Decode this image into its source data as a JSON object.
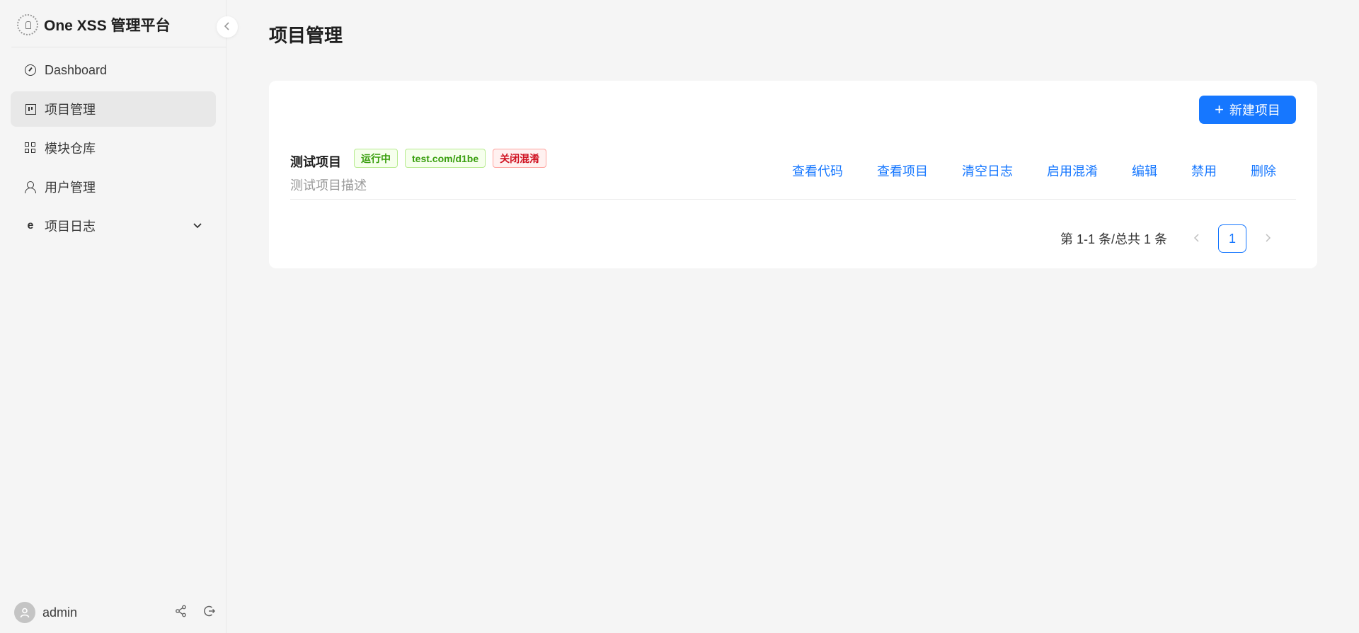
{
  "sidebar": {
    "brand_title": "One XSS 管理平台",
    "collapse_icon": "chevron-left-icon",
    "items": [
      {
        "label": "Dashboard",
        "icon": "dashboard-icon",
        "active": false
      },
      {
        "label": "项目管理",
        "icon": "project-icon",
        "active": true
      },
      {
        "label": "模块仓库",
        "icon": "module-icon",
        "active": false
      },
      {
        "label": "用户管理",
        "icon": "user-icon",
        "active": false
      },
      {
        "label": "项目日志",
        "icon": "log-icon",
        "active": false,
        "expandable": true
      }
    ],
    "user": {
      "name": "admin"
    }
  },
  "main": {
    "title": "项目管理",
    "new_button_label": "新建项目",
    "projects": [
      {
        "name": "测试项目",
        "tags": {
          "status": "运行中",
          "domain": "test.com/d1be",
          "obfuscation": "关闭混淆"
        },
        "description": "测试项目描述",
        "actions": [
          "查看代码",
          "查看项目",
          "清空日志",
          "启用混淆",
          "编辑",
          "禁用",
          "删除"
        ]
      }
    ],
    "pagination": {
      "total_text": "第 1-1 条/总共 1 条",
      "current_page": "1"
    }
  },
  "colors": {
    "primary": "#1677ff",
    "tag_green": "#389e0d",
    "tag_red": "#cf1322"
  }
}
